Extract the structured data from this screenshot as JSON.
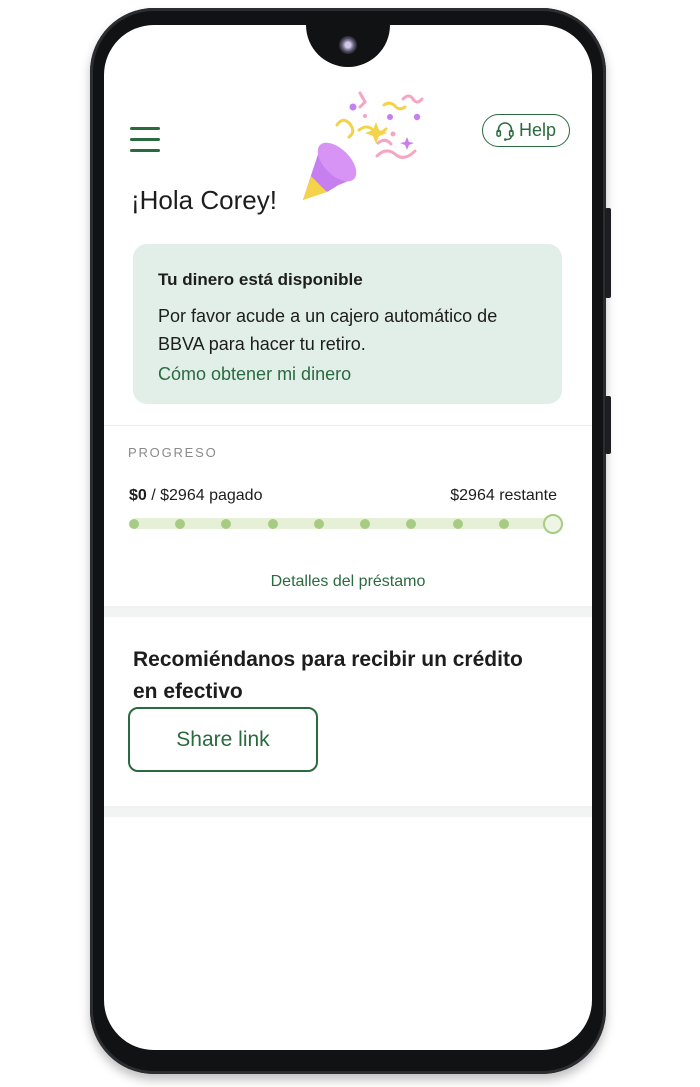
{
  "header": {
    "greeting": "¡Hola Corey!",
    "help_label": "Help",
    "menu_icon": "hamburger-menu-icon",
    "help_icon": "headset-icon",
    "celebration_icon": "party-popper-icon"
  },
  "notice": {
    "title": "Tu dinero está disponible",
    "body": "Por favor acude a un cajero automático de BBVA para hacer tu retiro.",
    "link": "Cómo obtener mi dinero"
  },
  "progress": {
    "label": "PROGRESO",
    "paid_amount": "$0",
    "paid_rest": " / $2964 pagado",
    "remaining": "$2964 restante",
    "paid_fraction": 0,
    "payment_count": 10,
    "details_link": "Detalles del préstamo"
  },
  "referral": {
    "title": "Recomiéndanos para recibir un crédito en efectivo",
    "share_label": "Share link"
  },
  "colors": {
    "accent": "#2a6a3f",
    "card_bg": "#e1efe8",
    "progress_track": "#e6f0d7",
    "progress_dot": "#a6cc84"
  }
}
